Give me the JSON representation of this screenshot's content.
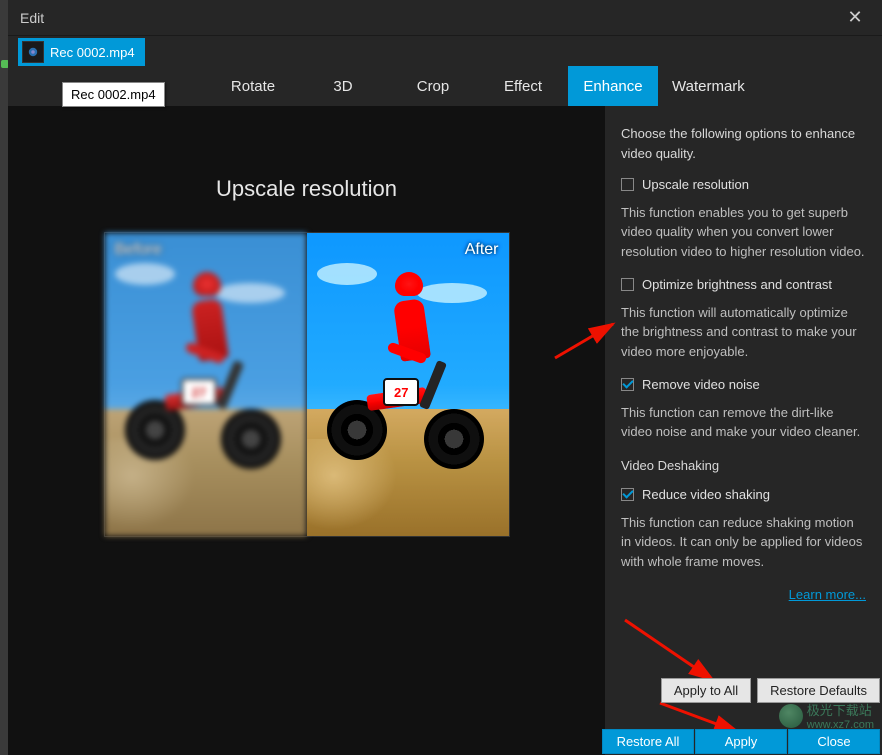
{
  "window": {
    "title": "Edit"
  },
  "filetab": {
    "name": "Rec 0002.mp4"
  },
  "tooltip": {
    "text": "Rec 0002.mp4"
  },
  "tabs": {
    "rotate": "Rotate",
    "threeD": "3D",
    "crop": "Crop",
    "effect": "Effect",
    "enhance": "Enhance",
    "watermark": "Watermark"
  },
  "preview": {
    "heading": "Upscale resolution",
    "before_label": "Before",
    "after_label": "After",
    "plate_number": "27"
  },
  "options": {
    "intro": "Choose the following options to enhance video quality.",
    "upscale": {
      "label": "Upscale resolution",
      "checked": false,
      "desc": "This function enables you to get superb video quality when you convert lower resolution video to higher resolution video."
    },
    "optimize": {
      "label": "Optimize brightness and contrast",
      "checked": false,
      "desc": "This function will automatically optimize the brightness and contrast to make your video more enjoyable."
    },
    "denoise": {
      "label": "Remove video noise",
      "checked": true,
      "desc": "This function can remove the dirt-like video noise and make your video cleaner."
    },
    "deshake_heading": "Video Deshaking",
    "deshake": {
      "label": "Reduce video shaking",
      "checked": true,
      "desc": "This function can reduce shaking motion in videos. It can only be applied for videos with whole frame moves."
    },
    "learn_more": "Learn more..."
  },
  "buttons": {
    "apply_all": "Apply to All",
    "restore_defaults": "Restore Defaults",
    "restore_all": "Restore All",
    "apply": "Apply",
    "close": "Close"
  },
  "watermark_ghost": {
    "line1": "极光下载站",
    "line2": "www.xz7.com"
  }
}
